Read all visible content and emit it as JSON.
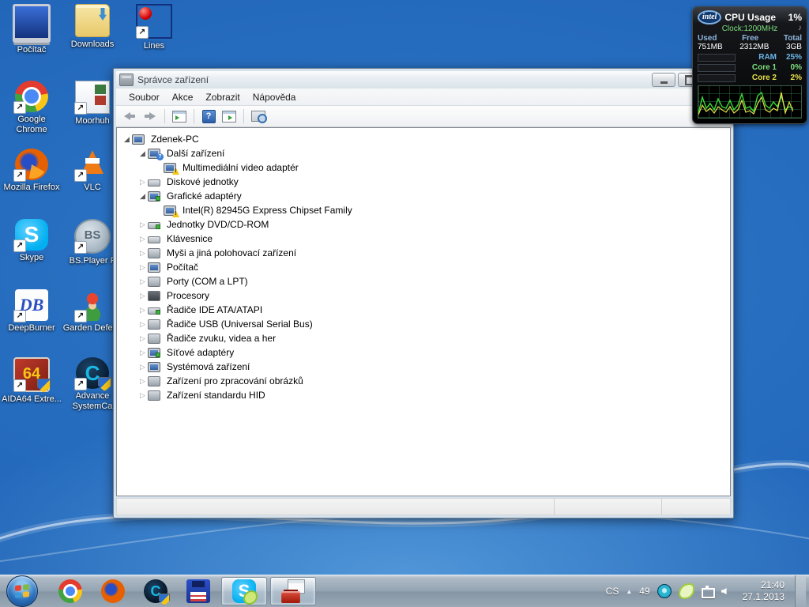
{
  "desktop": {
    "icons": [
      {
        "name": "pocitac",
        "label": "Počítač",
        "art": "computer",
        "shortcut": false
      },
      {
        "name": "downloads",
        "label": "Downloads",
        "art": "folder-download",
        "shortcut": false
      },
      {
        "name": "lines",
        "label": "Lines",
        "art": "lines",
        "shortcut": true
      },
      {
        "name": "google-chrome",
        "label": "Google Chrome",
        "art": "chrome",
        "shortcut": true
      },
      {
        "name": "moorhuhn",
        "label": "Moorhuh",
        "art": "page",
        "shortcut": true
      },
      {
        "name": "mozilla-firefox",
        "label": "Mozilla Firefox",
        "art": "firefox",
        "shortcut": true
      },
      {
        "name": "vlc",
        "label": "VLC",
        "art": "vlc",
        "shortcut": true
      },
      {
        "name": "skype",
        "label": "Skype",
        "art": "skype",
        "shortcut": true
      },
      {
        "name": "bs-player",
        "label": "BS.Player F",
        "art": "bsplayer",
        "shortcut": true
      },
      {
        "name": "deepburner",
        "label": "DeepBurner",
        "art": "deepburner",
        "shortcut": true
      },
      {
        "name": "garden-defence",
        "label": "Garden Defenc",
        "art": "garden",
        "shortcut": true
      },
      {
        "name": "aida64-extreme",
        "label": "AIDA64 Extre...",
        "art": "aida64",
        "shortcut": true,
        "shield": true
      },
      {
        "name": "advanced-systemcare",
        "label": "Advance SystemCa",
        "art": "asc",
        "shortcut": true,
        "shield": true
      }
    ]
  },
  "gadget": {
    "brand": "intel",
    "title": "CPU Usage",
    "usage": "1%",
    "clock": "Clock:1200MHz",
    "note_icon": "♪",
    "columns": {
      "used": "Used",
      "free": "Free",
      "total": "Total"
    },
    "memory": {
      "used": "751MB",
      "free": "2312MB",
      "total": "3GB"
    },
    "rows": [
      {
        "label": "RAM",
        "value": "25%",
        "color": "#6cb6e8",
        "fill": 25
      },
      {
        "label": "Core 1",
        "value": "0%",
        "color": "#7fe07f",
        "fill": 2
      },
      {
        "label": "Core 2",
        "value": "2%",
        "color": "#e8e04a",
        "fill": 4
      }
    ],
    "chart_colors": {
      "line1": "#39d839",
      "line2": "#e8e04a"
    }
  },
  "window": {
    "title": "Správce zařízení",
    "controls": [
      "minimize",
      "maximize",
      "close"
    ],
    "menu": [
      "Soubor",
      "Akce",
      "Zobrazit",
      "Nápověda"
    ],
    "toolbar": [
      "back",
      "forward",
      "show-console-tree",
      "help",
      "export-list",
      "scan-hardware-changes"
    ],
    "tree": {
      "items": [
        {
          "label": "Zdenek-PC",
          "indent": 0,
          "state": "expanded",
          "icon": "computer",
          "badge": null
        },
        {
          "label": "Další zařízení",
          "indent": 1,
          "state": "expanded",
          "icon": "unknown-device",
          "badge": "question"
        },
        {
          "label": "Multimediální video adaptér",
          "indent": 2,
          "state": "leaf",
          "icon": "video-device",
          "badge": "warning"
        },
        {
          "label": "Diskové jednotky",
          "indent": 1,
          "state": "collapsed",
          "icon": "disk-drive",
          "badge": null
        },
        {
          "label": "Grafické adaptéry",
          "indent": 1,
          "state": "expanded",
          "icon": "display-adapter",
          "badge": "green"
        },
        {
          "label": "Intel(R) 82945G Express Chipset Family",
          "indent": 2,
          "state": "leaf",
          "icon": "display-adapter",
          "badge": "warning"
        },
        {
          "label": "Jednotky DVD/CD-ROM",
          "indent": 1,
          "state": "collapsed",
          "icon": "dvd-drive",
          "badge": "green"
        },
        {
          "label": "Klávesnice",
          "indent": 1,
          "state": "collapsed",
          "icon": "keyboard",
          "badge": null
        },
        {
          "label": "Myši a jiná polohovací zařízení",
          "indent": 1,
          "state": "collapsed",
          "icon": "mouse",
          "badge": null
        },
        {
          "label": "Počítač",
          "indent": 1,
          "state": "collapsed",
          "icon": "computer-device",
          "badge": null
        },
        {
          "label": "Porty (COM a LPT)",
          "indent": 1,
          "state": "collapsed",
          "icon": "ports",
          "badge": null
        },
        {
          "label": "Procesory",
          "indent": 1,
          "state": "collapsed",
          "icon": "processor",
          "badge": null
        },
        {
          "label": "Řadiče IDE ATA/ATAPI",
          "indent": 1,
          "state": "collapsed",
          "icon": "ide-controller",
          "badge": "green"
        },
        {
          "label": "Řadiče USB (Universal Serial Bus)",
          "indent": 1,
          "state": "collapsed",
          "icon": "usb-controller",
          "badge": null
        },
        {
          "label": "Řadiče zvuku, videa a her",
          "indent": 1,
          "state": "collapsed",
          "icon": "sound-device",
          "badge": null
        },
        {
          "label": "Síťové adaptéry",
          "indent": 1,
          "state": "collapsed",
          "icon": "network-adapter",
          "badge": "green"
        },
        {
          "label": "Systémová zařízení",
          "indent": 1,
          "state": "collapsed",
          "icon": "system-device",
          "badge": null
        },
        {
          "label": "Zařízení pro zpracování obrázků",
          "indent": 1,
          "state": "collapsed",
          "icon": "imaging-device",
          "badge": null
        },
        {
          "label": "Zařízení standardu HID",
          "indent": 1,
          "state": "collapsed",
          "icon": "hid-device",
          "badge": null
        }
      ]
    }
  },
  "taskbar": {
    "start": "start",
    "apps": [
      {
        "name": "chrome-taskbar",
        "art": "chrome",
        "open": false
      },
      {
        "name": "firefox-taskbar",
        "art": "firefox",
        "open": false
      },
      {
        "name": "systemcare-taskbar",
        "art": "asc",
        "open": false
      },
      {
        "name": "floppy-taskbar",
        "art": "floppy",
        "open": false
      },
      {
        "name": "skype-taskbar",
        "art": "skype",
        "open": true
      },
      {
        "name": "device-manager-taskbar",
        "art": "toolbox",
        "open": true
      }
    ],
    "tray": {
      "language": "CS",
      "counter": "49",
      "icons": [
        "status-eye",
        "green-status",
        "network",
        "volume"
      ],
      "time": "21:40",
      "date": "27.1.2013"
    }
  }
}
